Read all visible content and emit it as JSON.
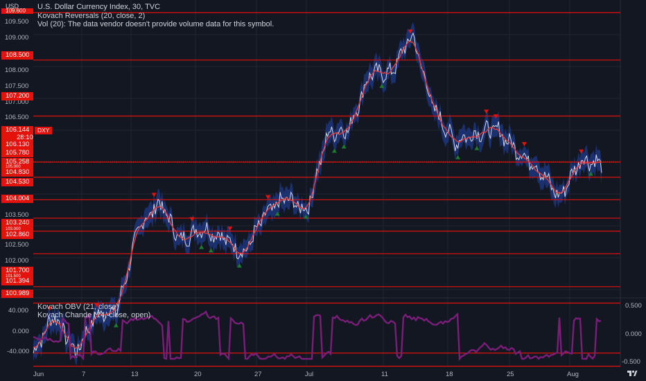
{
  "header": {
    "currency": "USD",
    "title": "U.S. Dollar Currency Index, 30, TVC",
    "indicator1": "Kovach Reversals (20, close, 2)",
    "indicator2": "Vol (20): The data vendor doesn't provide volume data for this symbol."
  },
  "oscillator": {
    "label1": "Kovach OBV (21, close)",
    "label2": "Kovach Chande (14, close, open)",
    "left_ticks": [
      "40.000",
      "0.000",
      "-40.000"
    ],
    "right_ticks": [
      "0.500",
      "0.000",
      "-0.500"
    ]
  },
  "price_axis": {
    "ticks": [
      "109.500",
      "109.000",
      "108.000",
      "107.500",
      "107.000",
      "106.500",
      "105.500",
      "103.500",
      "102.500",
      "102.000",
      "101.000"
    ],
    "levels": [
      "109.600",
      "108.500",
      "107.200",
      "106.130",
      "105.780",
      "105.258",
      "105.000",
      "104.830",
      "104.530",
      "104.004",
      "103.240",
      "103.000",
      "102.860",
      "101.700",
      "101.500",
      "101.394",
      "100.989"
    ],
    "current_price": "106.144",
    "countdown": "28:10",
    "symbol": "DXY"
  },
  "time_axis": [
    "Jun",
    "7",
    "13",
    "20",
    "27",
    "Jul",
    "11",
    "18",
    "25",
    "Aug"
  ],
  "colors": {
    "background": "#131722",
    "level_line": "#e3120b",
    "band": "#1e3a8a",
    "price": "#d8d8e0",
    "midline": "#e23a3a",
    "up_marker": "#1e7a2e",
    "down_marker": "#e3120b",
    "oscillator": "#7b1e7a"
  },
  "chart_data": {
    "type": "line",
    "title": "U.S. Dollar Currency Index, 30, TVC",
    "ylim": [
      100.9,
      109.9
    ],
    "x": [
      "Jun",
      "7",
      "13",
      "20",
      "27",
      "Jul",
      "11",
      "18",
      "25",
      "Aug"
    ],
    "series": [
      {
        "values": [
          101.7,
          102.6,
          101.7,
          102.6,
          102.7,
          104.6,
          105.2,
          104.3,
          104.6,
          104.4,
          104.0,
          104.9,
          105.3,
          105.0,
          106.8,
          106.9,
          108.2,
          108.2,
          109.1,
          107.4,
          106.6,
          106.8,
          106.9,
          106.4,
          106.0,
          105.3,
          106.2,
          106.1
        ]
      }
    ],
    "resistance_levels": [
      109.6,
      108.5,
      107.2,
      106.13,
      105.78,
      105.258,
      104.83,
      104.53,
      104.004,
      103.24,
      102.86,
      101.7,
      101.394,
      100.989
    ]
  }
}
